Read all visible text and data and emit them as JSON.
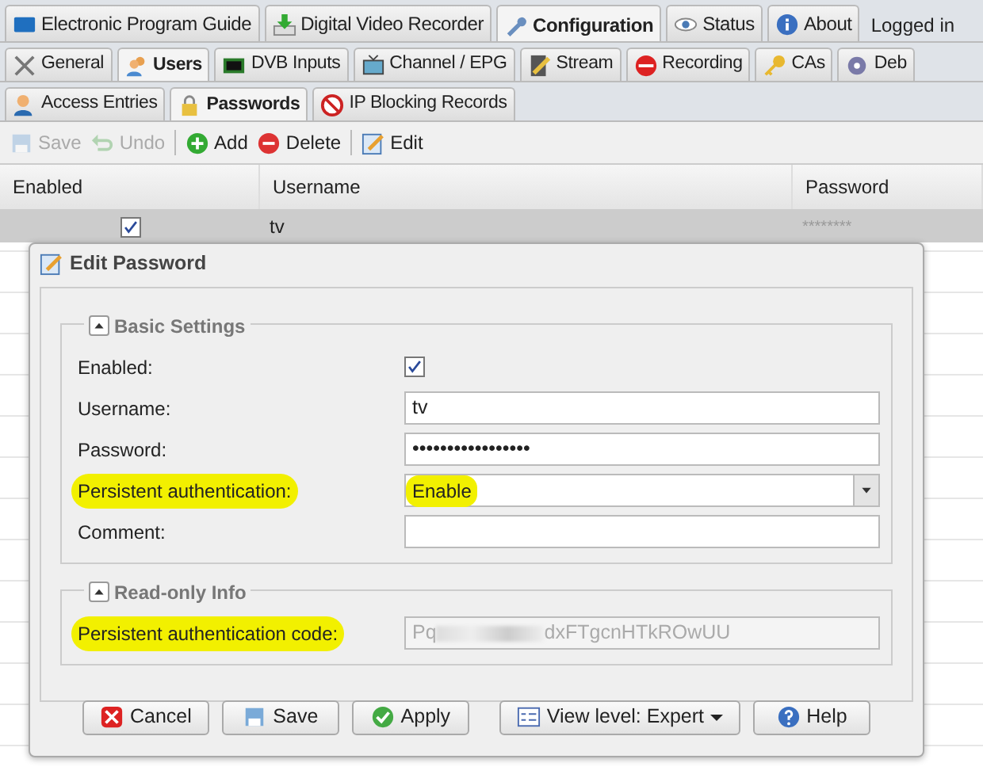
{
  "main_tabs": [
    {
      "label": "Electronic Program Guide",
      "selected": false
    },
    {
      "label": "Digital Video Recorder",
      "selected": false
    },
    {
      "label": "Configuration",
      "selected": true
    },
    {
      "label": "Status",
      "selected": false
    },
    {
      "label": "About",
      "selected": false
    }
  ],
  "login_text": "Logged in",
  "config_tabs": [
    {
      "label": "General",
      "selected": false
    },
    {
      "label": "Users",
      "selected": true
    },
    {
      "label": "DVB Inputs",
      "selected": false
    },
    {
      "label": "Channel / EPG",
      "selected": false
    },
    {
      "label": "Stream",
      "selected": false
    },
    {
      "label": "Recording",
      "selected": false
    },
    {
      "label": "CAs",
      "selected": false
    },
    {
      "label": "Deb",
      "selected": false
    }
  ],
  "user_tabs": [
    {
      "label": "Access Entries",
      "selected": false
    },
    {
      "label": "Passwords",
      "selected": true
    },
    {
      "label": "IP Blocking Records",
      "selected": false
    }
  ],
  "toolbar": [
    {
      "label": "Save",
      "disabled": true
    },
    {
      "label": "Undo",
      "disabled": true
    },
    {
      "label": "Add",
      "disabled": false
    },
    {
      "label": "Delete",
      "disabled": false
    },
    {
      "label": "Edit",
      "disabled": false
    }
  ],
  "grid": {
    "columns": [
      "Enabled",
      "Username",
      "Password"
    ],
    "rows": [
      {
        "enabled": true,
        "username": "tv",
        "password": "********",
        "selected": true
      }
    ]
  },
  "dialog": {
    "title": "Edit Password",
    "basic": {
      "legend": "Basic Settings",
      "fields": [
        {
          "kind": "checkbox",
          "label": "Enabled:",
          "checked": true,
          "highlighted": false
        },
        {
          "kind": "text",
          "label": "Username:",
          "value": "tv",
          "highlighted": false
        },
        {
          "kind": "text",
          "label": "Password:",
          "value": "•••••••••••••••••",
          "highlighted": false
        },
        {
          "kind": "select",
          "label": "Persistent authentication:",
          "value": "Enable",
          "highlighted": true
        },
        {
          "kind": "text",
          "label": "Comment:",
          "highlighted": false
        }
      ]
    },
    "readonly": {
      "legend": "Read-only Info",
      "label": "Persistent authentication code:",
      "code_start": "Pq",
      "code_end": "dxFTgcnHTkROwUU",
      "highlighted": true
    },
    "buttons": [
      "Cancel",
      "Save",
      "Apply"
    ],
    "view_level": "View level: Expert",
    "help": "Help"
  }
}
